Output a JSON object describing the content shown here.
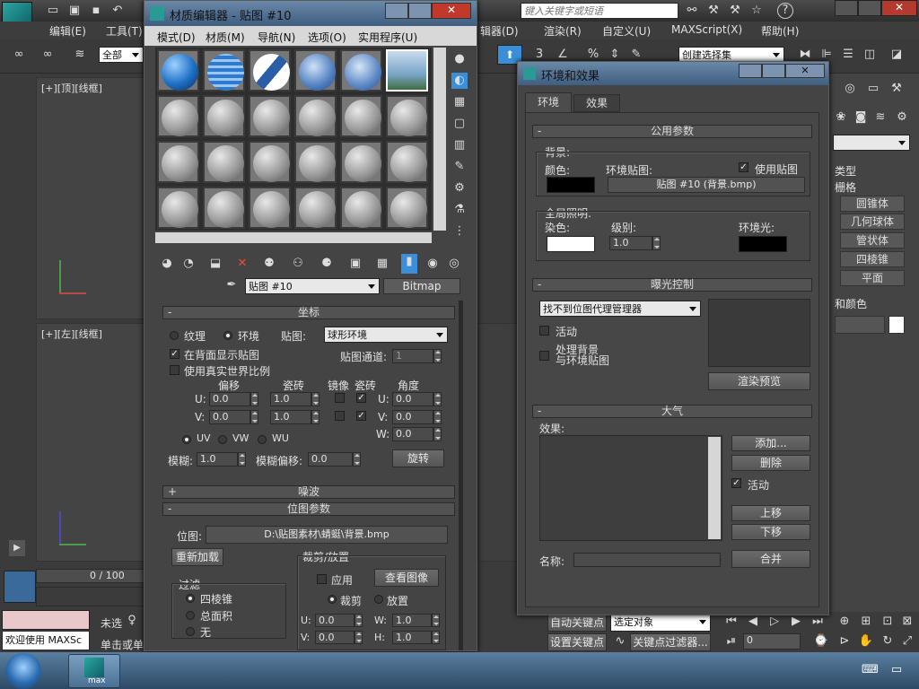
{
  "main_window": {
    "menu": [
      "编辑(E)",
      "工具(T)"
    ],
    "menu_right": [
      "辑器(D)",
      "渲染(R)",
      "自定义(U)",
      "MAXScript(X)",
      "帮助(H)"
    ],
    "search_placeholder": "键入关键字或短语",
    "selection_filter": "全部",
    "named_selection": "创建选择集",
    "vp_top_label": "[+][顶][线框]",
    "vp_left_label": "[+][左][线框]",
    "frame_counter": "0 / 100",
    "status_unselected": "未选",
    "status_hint": "单击或单",
    "welcome": "欢迎使用 MAXSc",
    "auto_key": "自动关键点",
    "set_key": "设置关键点",
    "selected_object": "选定对象",
    "key_filters": "关键点过滤器...",
    "frame_value": "0"
  },
  "cmd_panel": {
    "dropdown": "",
    "object_type_header": "类型",
    "grid_label": "栅格",
    "buttons": [
      "圆锥体",
      "几何球体",
      "管状体",
      "四棱锥",
      "平面"
    ],
    "name_color": "和颜色"
  },
  "mat_editor": {
    "title": "材质编辑器 - 贴图 #10",
    "menu": [
      "模式(D)",
      "材质(M)",
      "导航(N)",
      "选项(O)",
      "实用程序(U)"
    ],
    "map_name": "贴图 #10",
    "map_type": "Bitmap",
    "coords": {
      "header": "坐标",
      "texture": "纹理",
      "environ": "环境",
      "mapping_label": "贴图:",
      "mapping_value": "球形环境",
      "show_bg": "在背面显示贴图",
      "map_channel": "贴图通道:",
      "map_channel_value": "1",
      "real_world": "使用真实世界比例",
      "offset": "偏移",
      "tiling": "瓷砖",
      "mirror": "镜像",
      "tile": "瓷砖",
      "angle": "角度",
      "u": "U:",
      "v": "V:",
      "w": "W:",
      "u_offset": "0.0",
      "v_offset": "0.0",
      "u_tiling": "1.0",
      "v_tiling": "1.0",
      "u_angle": "0.0",
      "v_angle": "0.0",
      "w_angle": "0.0",
      "uv": "UV",
      "vw": "VW",
      "wu": "WU",
      "blur": "模糊:",
      "blur_value": "1.0",
      "blur_offset": "模糊偏移:",
      "blur_offset_value": "0.0",
      "rotate": "旋转"
    },
    "noise_header": "噪波",
    "bitmap": {
      "header": "位图参数",
      "bitmap_label": "位图:",
      "bitmap_path": "D:\\贴图素材\\蜻蜓\\背景.bmp",
      "reload": "重新加载",
      "crop_place": "裁剪/放置",
      "apply": "应用",
      "view_image": "查看图像",
      "crop": "裁剪",
      "place": "放置",
      "filter": "过滤",
      "pyramidal": "四棱锥",
      "summed": "总面积",
      "none": "无",
      "u": "U:",
      "v": "V:",
      "w": "W:",
      "h": "H:",
      "u_val": "0.0",
      "v_val": "0.0",
      "w_val": "1.0",
      "h_val": "1.0"
    }
  },
  "env_dialog": {
    "title": "环境和效果",
    "tabs": [
      "环境",
      "效果"
    ],
    "common_header": "公用参数",
    "background": "背景:",
    "color": "颜色:",
    "env_map": "环境贴图:",
    "use_map": "使用贴图",
    "map_button": "贴图 #10 (背景.bmp)",
    "global_light": "全局照明:",
    "tint": "染色:",
    "level": "级别:",
    "level_value": "1.0",
    "ambient": "环境光:",
    "exposure_header": "曝光控制",
    "exposure_value": "找不到位图代理管理器",
    "active": "活动",
    "process_bg": "处理背景",
    "process_bg2": "与环境贴图",
    "render_preview": "渲染预览",
    "atmos_header": "大气",
    "effects": "效果:",
    "add": "添加...",
    "delete": "删除",
    "active2": "活动",
    "move_up": "上移",
    "move_down": "下移",
    "name_label": "名称:",
    "merge": "合并"
  },
  "taskbar": {
    "app_label": "max"
  },
  "colors": {
    "accent": "#3a8fd8",
    "panel": "#444444",
    "title_active": "#5b8ec2"
  }
}
